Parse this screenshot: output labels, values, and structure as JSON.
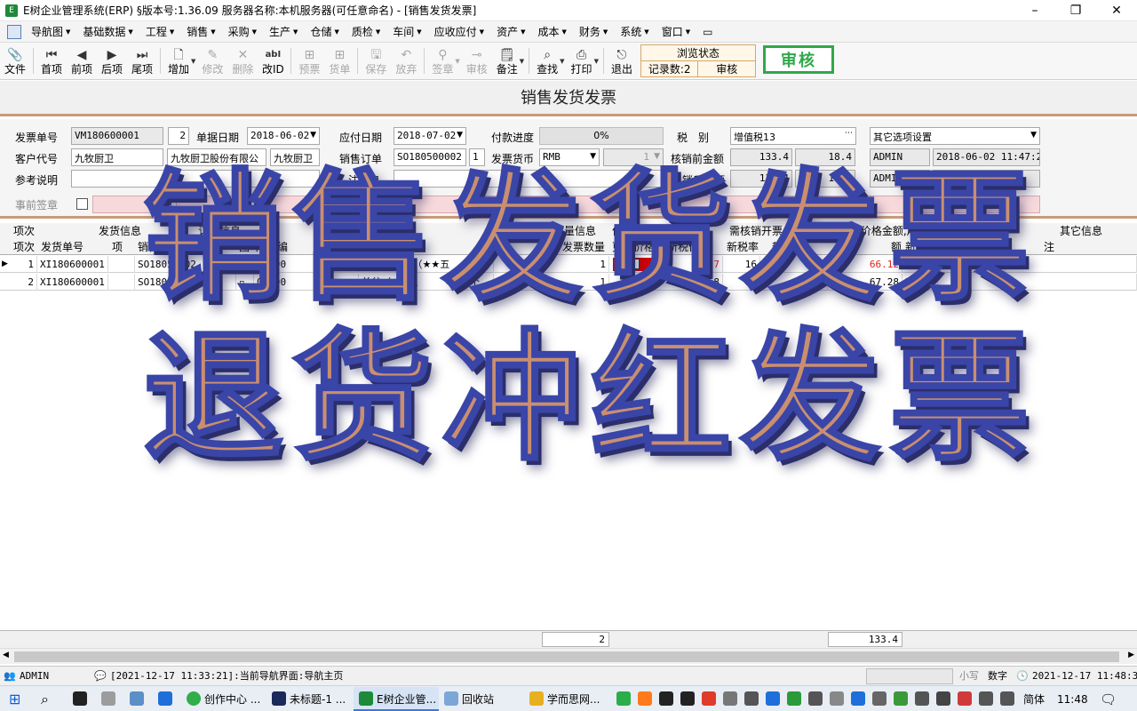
{
  "window": {
    "title": "E树企业管理系统(ERP) §版本号:1.36.09  服务器名称:本机服务器(可任意命名) - [销售发货发票]",
    "app_icon": "E",
    "min": "–",
    "max": "❐",
    "close": "✕"
  },
  "menu": [
    "导航图",
    "基础数据",
    "工程",
    "销售",
    "采购",
    "生产",
    "仓储",
    "质检",
    "车间",
    "应收应付",
    "资产",
    "成本",
    "财务",
    "系统",
    "窗口"
  ],
  "toolbar": {
    "file": "文件",
    "first": "首项",
    "prev": "前项",
    "next": "后项",
    "last": "尾项",
    "add": "增加",
    "edit": "修改",
    "delete": "删除",
    "change_id": "改ID",
    "prev_ticket": "预票",
    "goods_ticket": "货单",
    "save": "保存",
    "abandon": "放弃",
    "sign": "签章",
    "audit_small": "审核",
    "note": "备注",
    "find": "查找",
    "print": "打印",
    "exit": "退出",
    "status_title": "浏览状态",
    "record_count": "记录数:2",
    "status_audit": "审核",
    "audit_button": "审核"
  },
  "form": {
    "title": "销售发货发票",
    "invoice_no_label": "发票单号",
    "invoice_no": "VM180600001",
    "invoice_seq": "2",
    "doc_date_label": "单据日期",
    "doc_date": "2018-06-02",
    "due_date_label": "应付日期",
    "due_date": "2018-07-02",
    "pay_progress_label": "付款进度",
    "pay_progress": "0%",
    "tax_label": "税　别",
    "tax": "增值税13",
    "other_opts": "其它选项设置",
    "cust_code_label": "客户代号",
    "cust_code": "九牧厨卫",
    "cust_name": "九牧厨卫股份有限公",
    "cust_short": "九牧厨卫",
    "sales_order_label": "销售订单",
    "sales_order": "SO180500002",
    "sales_order_seq": "1",
    "currency_label": "发票货币",
    "currency": "RMB",
    "rate": "1",
    "pre_amount_label": "核销前金额",
    "pre_amount": "133.4",
    "pre_tax": "18.4",
    "user1": "ADMIN",
    "datetime1": "2018-06-02 11:47:21",
    "ref_label": "参考说明",
    "note_label": "注信息",
    "post_amount_label": "销后金额",
    "post_amount": "133.4",
    "post_tax": "18.4",
    "user2": "ADMIN",
    "pre_sign_label": "事前签章",
    "memo_label": "备注"
  },
  "grid": {
    "group_headers": [
      "项次",
      "发货信息",
      "订单信息",
      "产品信息",
      "数量控制",
      "数量信息",
      "价格控制",
      "需核销开票,未核销时会重算价格金额,用户无需输入",
      "其它信息"
    ],
    "headers": [
      "项次",
      "发货单号",
      "项",
      "销售订",
      "项",
      "图",
      "产品编",
      "产品名称",
      "",
      "发票数量",
      "更改价格",
      "新税价格",
      "新税率",
      "新含",
      "",
      "额",
      "新货",
      "注"
    ],
    "rows": [
      {
        "seq": "1",
        "ship_no": "XI180600001",
        "order": "SO1805",
        "order_item": "002",
        "prod_code": "06000",
        "prod_name": "9540B单盆（★★五",
        "unit": "",
        "qty": "1",
        "price": "57",
        "tax_rate": "16",
        "new_price": "",
        "amount": "66.12",
        "currency": "RMB",
        "qty2": "1"
      },
      {
        "seq": "2",
        "ship_no": "XI180600001",
        "order": "SO1805",
        "order_item": "002",
        "prod_code": "06000",
        "prod_name": "单盆（★★五",
        "unit": "个",
        "qty": "1",
        "price": "58",
        "tax_rate": "16",
        "new_price": "67.2",
        "amount": "67.28",
        "currency": "RMB",
        "qty2": "1"
      }
    ]
  },
  "sums": {
    "qty_total": "2",
    "amount_total": "133.4"
  },
  "statusbar": {
    "user": "ADMIN",
    "message": "[2021-12-17 11:33:21]:当前导航界面:导航主页",
    "caps": "小写",
    "num": "数字",
    "clock": "2021-12-17 11:48:31"
  },
  "taskbar": {
    "items": [
      "创作中心 ...",
      "未标题-1 ...",
      "E树企业管...",
      "回收站",
      "学而思网..."
    ],
    "lang": "简体",
    "time": "11:48"
  },
  "overlay": {
    "line1": "销售发货发票",
    "line2": "退货冲红发票"
  },
  "colors": {
    "accent_border": "#c89a7a",
    "audit_green": "#2fa84a",
    "negative_red": "#d22"
  }
}
